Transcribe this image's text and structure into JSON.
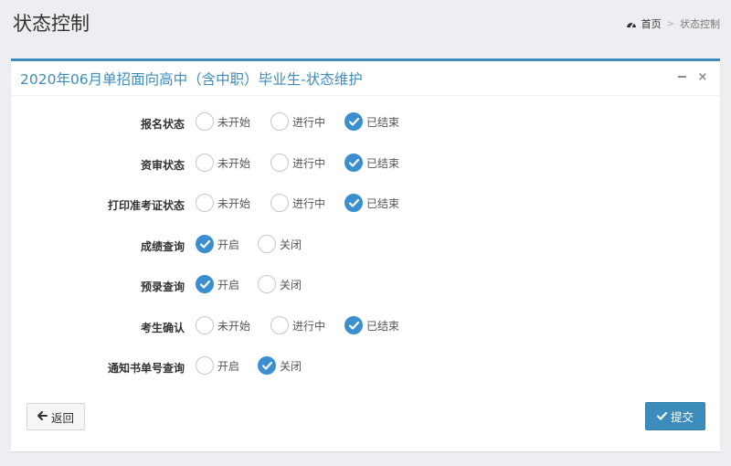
{
  "header": {
    "title": "状态控制",
    "breadcrumb": {
      "home_label": "首页",
      "separator": ">",
      "current": "状态控制"
    }
  },
  "panel": {
    "title": "2020年06月单招面向高中（含中职）毕业生-状态维护",
    "minimize_icon": "minus-icon",
    "close_symbol": "×",
    "accent_color": "#3c8dbc"
  },
  "rows": [
    {
      "label": "报名状态",
      "options": [
        "未开始",
        "进行中",
        "已结束"
      ],
      "selected": "已结束"
    },
    {
      "label": "资审状态",
      "options": [
        "未开始",
        "进行中",
        "已结束"
      ],
      "selected": "已结束"
    },
    {
      "label": "打印准考证状态",
      "options": [
        "未开始",
        "进行中",
        "已结束"
      ],
      "selected": "已结束"
    },
    {
      "label": "成绩查询",
      "options": [
        "开启",
        "关闭"
      ],
      "selected": "开启"
    },
    {
      "label": "预录查询",
      "options": [
        "开启",
        "关闭"
      ],
      "selected": "开启"
    },
    {
      "label": "考生确认",
      "options": [
        "未开始",
        "进行中",
        "已结束"
      ],
      "selected": "已结束"
    },
    {
      "label": "通知书单号查询",
      "options": [
        "开启",
        "关闭"
      ],
      "selected": "关闭"
    }
  ],
  "footer": {
    "back_label": "返回",
    "back_icon": "arrow-left-icon",
    "submit_label": "提交",
    "submit_icon": "check-icon"
  }
}
